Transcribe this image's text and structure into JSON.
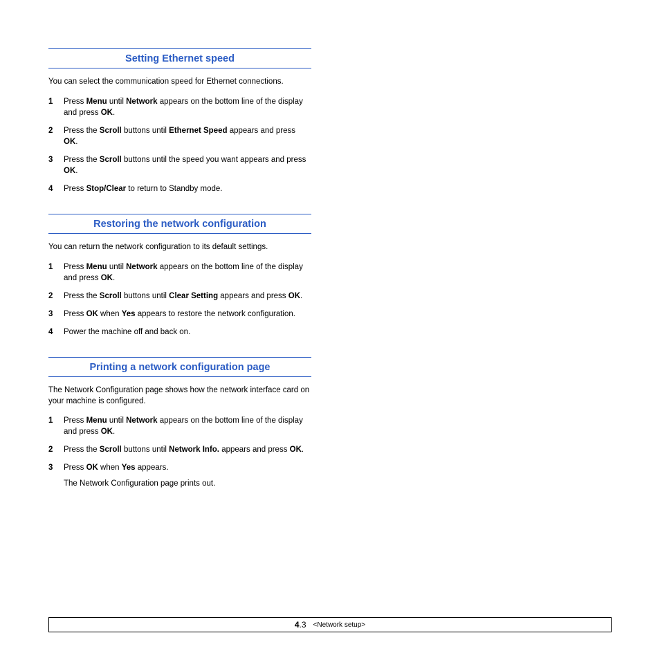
{
  "sections": [
    {
      "title": "Setting Ethernet speed",
      "intro": "You can select the communication speed for Ethernet connections.",
      "steps": [
        {
          "html": "Press <b>Menu</b> until <b>Network</b> appears on the bottom line of the display and press <b>OK</b>."
        },
        {
          "html": "Press the <b>Scroll</b> buttons until <b>Ethernet Speed</b> appears and press <b>OK</b>."
        },
        {
          "html": "Press the <b>Scroll</b> buttons until the speed you want appears and press <b>OK</b>."
        },
        {
          "html": "Press <b>Stop/Clear</b> to return to Standby mode."
        }
      ]
    },
    {
      "title": "Restoring the network configuration",
      "intro": "You can return the network configuration to its default settings.",
      "steps": [
        {
          "html": "Press <b>Menu</b> until <b>Network</b> appears on the bottom line of the display and press <b>OK</b>."
        },
        {
          "html": "Press the <b>Scroll</b> buttons until <b>Clear Setting</b> appears and press <b>OK</b>."
        },
        {
          "html": "Press <b>OK</b> when <b>Yes</b> appears to restore the network configuration."
        },
        {
          "html": "Power the machine off and back on."
        }
      ]
    },
    {
      "title": "Printing a network configuration page",
      "intro": "The Network Configuration page shows how the network interface card on your machine is configured.",
      "steps": [
        {
          "html": "Press <b>Menu</b> until <b>Network</b> appears on the bottom line of the display and press <b>OK</b>."
        },
        {
          "html": "Press the <b>Scroll</b> buttons until <b>Network Info.</b> appears and press <b>OK</b>."
        },
        {
          "html": "Press <b>OK</b> when <b>Yes</b> appears.",
          "after": "The Network Configuration page prints out."
        }
      ]
    }
  ],
  "footer": {
    "chapter": "4",
    "page": ".3",
    "label": "<Network setup>"
  }
}
